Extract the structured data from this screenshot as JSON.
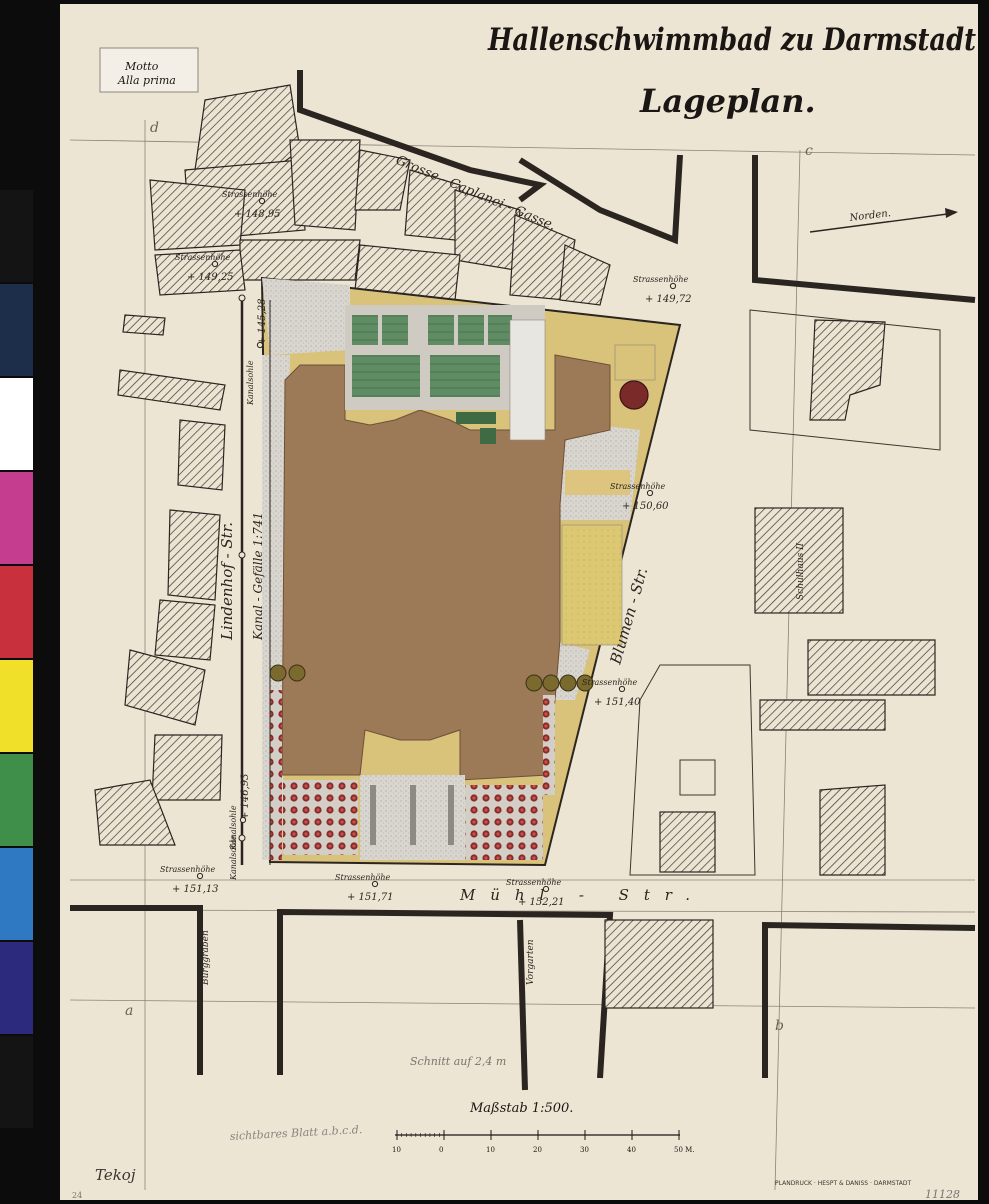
{
  "title": "Hallenschwimmbad zu Darmstadt",
  "subtitle": "Lageplan.",
  "motto_label": {
    "line1": "Motto",
    "line2": "Alla prima"
  },
  "north_label": "Norden.",
  "streets": {
    "grosse_caplanei": "Grosse - Caplanei - Gasse.",
    "lindenhof": "Lindenhof - Str.",
    "canal": "Kanal - Gefälle 1:741",
    "blumen": "Blumen - Str.",
    "muehl": "Mühl - Str.",
    "burggraben": "Burggraben",
    "vorgarten": "Vorgarten",
    "kanalsohle": "Kanalsohle"
  },
  "elevations": [
    {
      "label": "Strassenhöhe",
      "value": "+ 148,95"
    },
    {
      "label": "Strassenhöhe",
      "value": "+ 149,25"
    },
    {
      "label": "Kanalsohle",
      "value": "+ 145,28"
    },
    {
      "label": "Strassenhöhe",
      "value": "+ 149,72"
    },
    {
      "label": "Strassenhöhe",
      "value": "+ 150,60"
    },
    {
      "label": "Strassenhöhe",
      "value": "+ 151,40"
    },
    {
      "label": "Kanalsohle",
      "value": "+ 146,93"
    },
    {
      "label": "Strassenhöhe",
      "value": "+ 151,13"
    },
    {
      "label": "Strassenhöhe",
      "value": "+ 151,71"
    },
    {
      "label": "Strassenhöhe",
      "value": "+ 152,21"
    }
  ],
  "building_labels": {
    "schulhaus": "Schulhaus II"
  },
  "section_marks": {
    "d": "d",
    "c": "c",
    "a": "a",
    "b": "b"
  },
  "annotations": {
    "verzeichnet": "Schnitt auf 2,4 m",
    "sichtbar": "sichtbares Blatt a.b.c.d.",
    "signature": "Tekoj"
  },
  "scale": {
    "title": "Maßstab 1:500.",
    "ticks": [
      "10",
      "0",
      "10",
      "20",
      "30",
      "40",
      "50 M."
    ]
  },
  "printer": "PLANDRUCK · HESPT & DANISS · DARMSTADT",
  "archive_number": "11128",
  "corner_mark": "24",
  "calibration_colors": [
    "#141414",
    "#1d2e4a",
    "#ffffff",
    "#c43d8f",
    "#c8303d",
    "#f0e02a",
    "#3f8f4a",
    "#2f78c2",
    "#2b2a7c",
    "#141414"
  ]
}
